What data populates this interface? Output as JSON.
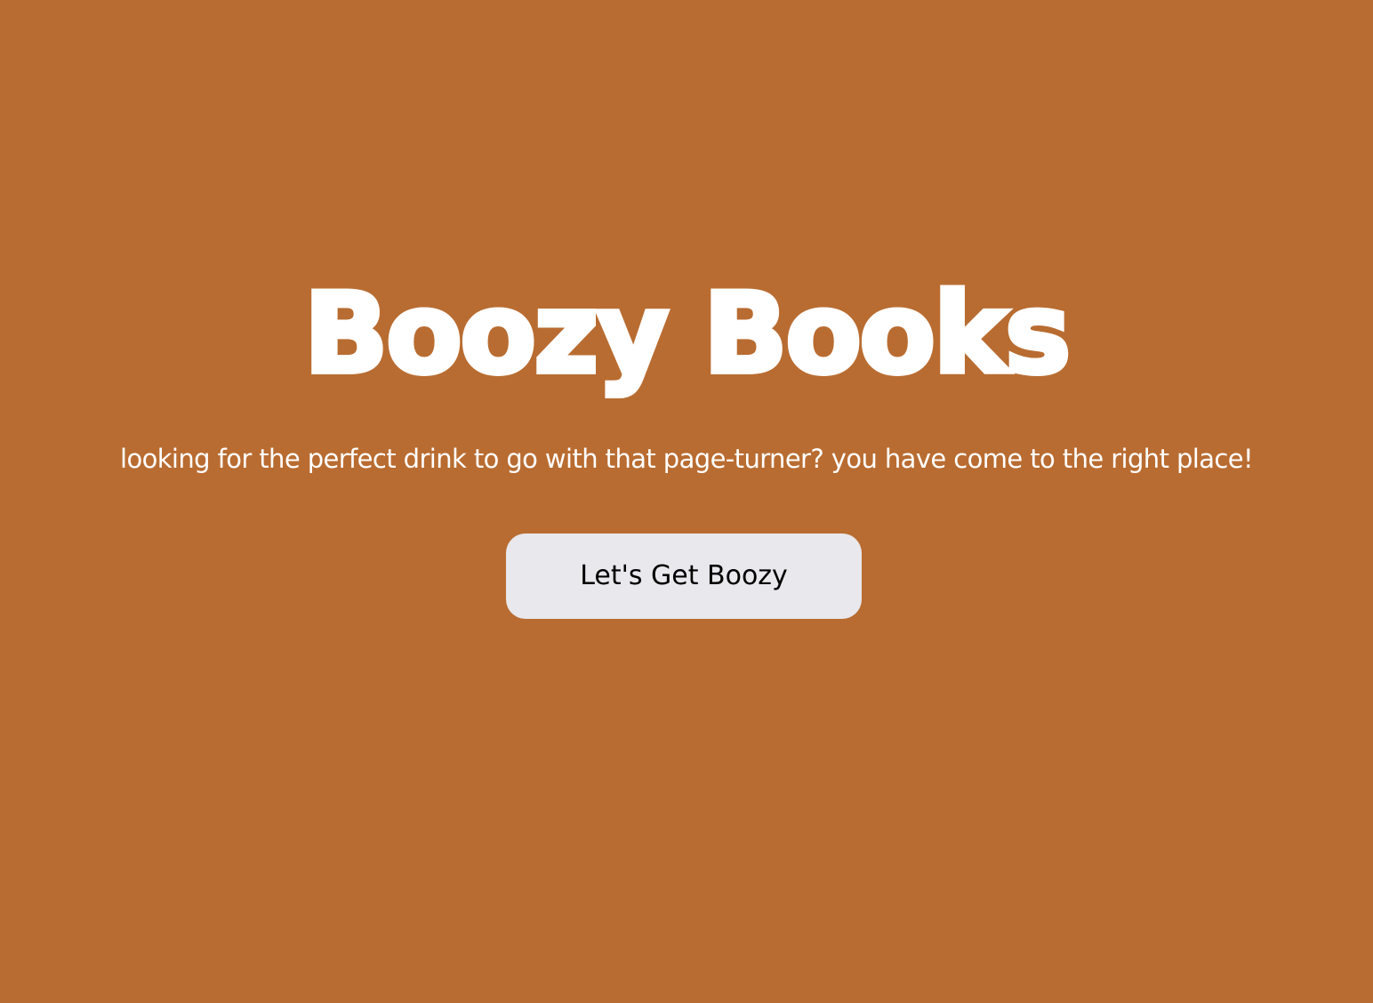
{
  "colors": {
    "background": "#b96c31",
    "title_text": "#ffffff",
    "tagline_text": "#ffffff",
    "button_background": "#e8e8ed",
    "button_text": "#000000"
  },
  "hero": {
    "title": "Boozy Books",
    "tagline": "looking for the perfect drink to go with that page-turner? you have come to the right place!",
    "cta_label": "Let's Get Boozy"
  }
}
